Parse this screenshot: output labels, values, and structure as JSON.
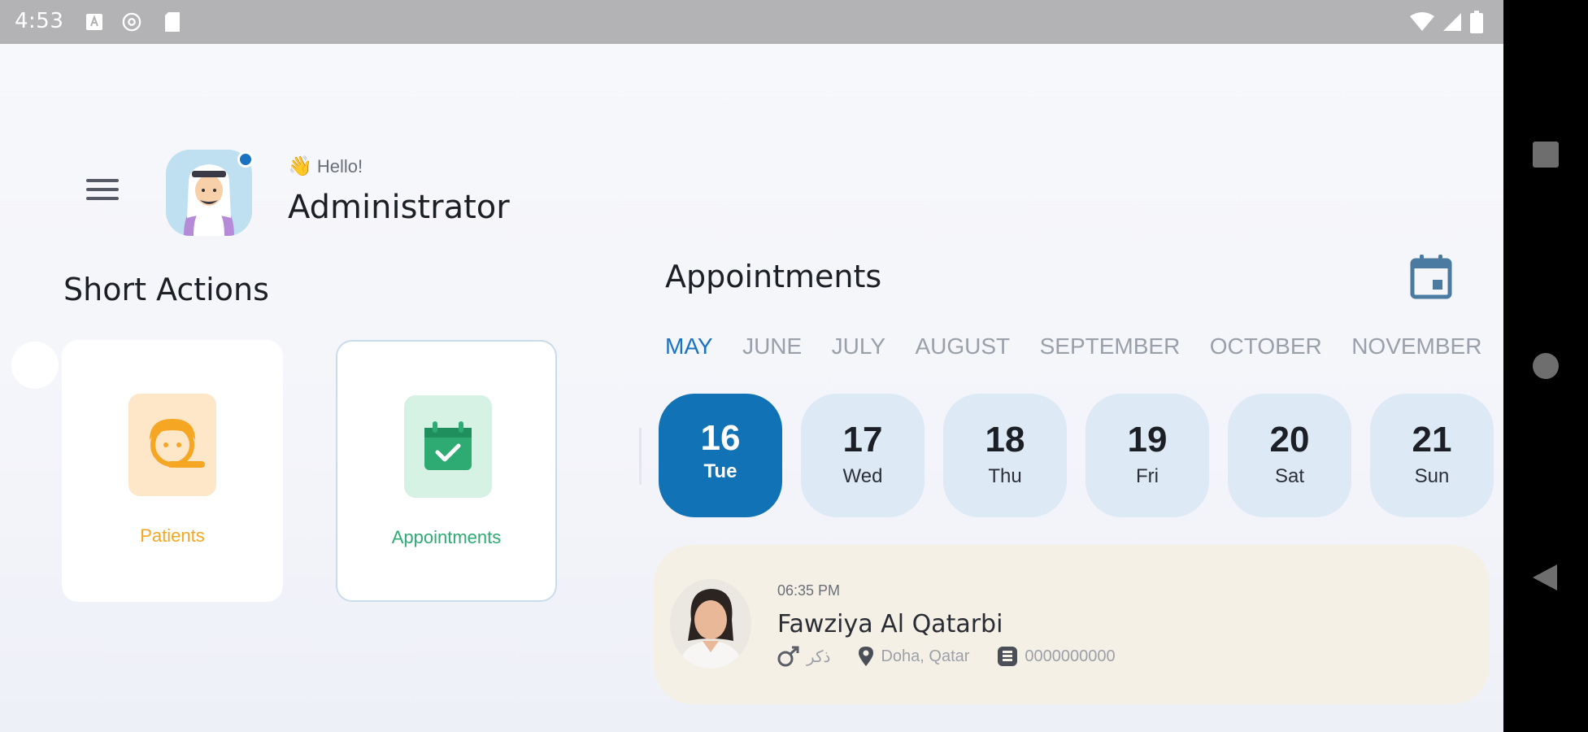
{
  "status_bar": {
    "time": "4:53"
  },
  "header": {
    "greeting_emoji": "👋",
    "greeting": "Hello!",
    "user_name": "Administrator"
  },
  "short_actions": {
    "title": "Short Actions",
    "cards": [
      {
        "label": "Patients",
        "color": "#f5a623",
        "bg": "#fde7c8"
      },
      {
        "label": "Appointments",
        "color": "#2eaa73",
        "bg": "#d6f2e4"
      }
    ]
  },
  "appointments": {
    "title": "Appointments",
    "months": [
      "MAY",
      "JUNE",
      "JULY",
      "AUGUST",
      "SEPTEMBER",
      "OCTOBER",
      "NOVEMBER"
    ],
    "selected_month": "MAY",
    "days": [
      {
        "num": "16",
        "name": "Tue"
      },
      {
        "num": "17",
        "name": "Wed"
      },
      {
        "num": "18",
        "name": "Thu"
      },
      {
        "num": "19",
        "name": "Fri"
      },
      {
        "num": "20",
        "name": "Sat"
      },
      {
        "num": "21",
        "name": "Sun"
      }
    ],
    "selected_day": "16",
    "item": {
      "time": "06:35 PM",
      "patient_name": "Fawziya Al Qatarbi",
      "gender": "ذكر",
      "location": "Doha, Qatar",
      "id_number": "0000000000"
    }
  },
  "colors": {
    "accent": "#1172b6",
    "card_bg": "#f5f0e6",
    "day_bg": "#ddeaf6"
  },
  "icons": {
    "menu": "hamburger-icon",
    "calendar": "calendar-icon",
    "gender": "male-icon",
    "location": "location-pin-icon",
    "id": "id-card-icon"
  }
}
